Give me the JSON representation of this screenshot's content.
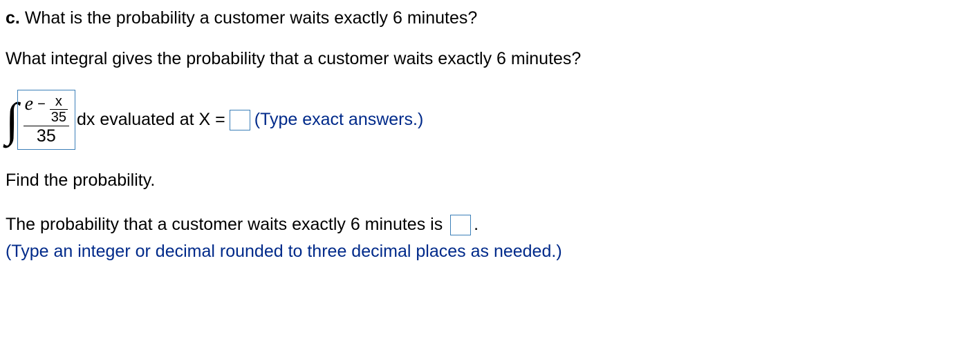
{
  "part_c": {
    "label": "c.",
    "question": "What is the probability a customer waits exactly 6 minutes?"
  },
  "subquestion": "What integral gives the probability that a customer waits exactly 6 minutes?",
  "integral": {
    "exp_minus": "−",
    "exp_numerator": "x",
    "exp_denominator": "35",
    "e": "e",
    "outer_denominator": "35",
    "dx_text": "dx evaluated at X =",
    "hint": "(Type exact answers.)"
  },
  "find_prob": "Find the probability.",
  "result": {
    "sentence_pre": "The probability that a customer waits exactly 6 minutes is ",
    "sentence_post": ".",
    "hint": "(Type an integer or decimal rounded to three decimal places as needed.)"
  }
}
